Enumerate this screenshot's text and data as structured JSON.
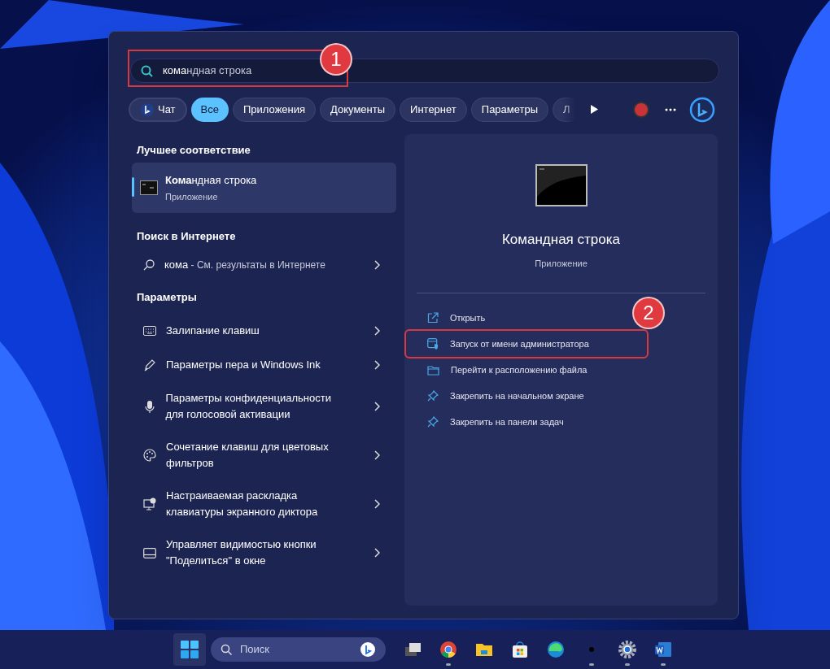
{
  "search": {
    "typed": "кома",
    "suggestion": "ндная строка"
  },
  "filters": [
    {
      "label": "Чат",
      "kind": "chat",
      "selected": false
    },
    {
      "label": "Все",
      "kind": "text",
      "selected": true
    },
    {
      "label": "Приложения",
      "kind": "text",
      "selected": false
    },
    {
      "label": "Документы",
      "kind": "text",
      "selected": false
    },
    {
      "label": "Интернет",
      "kind": "text",
      "selected": false
    },
    {
      "label": "Параметры",
      "kind": "text",
      "selected": false
    },
    {
      "label": "Л",
      "kind": "text",
      "selected": false
    }
  ],
  "best_match": {
    "heading": "Лучшее соответствие",
    "title_typed": "Кома",
    "title_rest": "ндная строка",
    "subtitle": "Приложение",
    "selected": true
  },
  "web_search": {
    "heading": "Поиск в Интернете",
    "query": "кома",
    "text": " - См. результаты в Интернете"
  },
  "settings": {
    "heading": "Параметры",
    "items": [
      {
        "kind": "keyboard",
        "label": "Залипание клавиш"
      },
      {
        "kind": "pen",
        "label": "Параметры пера и Windows Ink"
      },
      {
        "kind": "mic",
        "label": "Параметры конфиденциальности для голосовой активации"
      },
      {
        "kind": "palette",
        "label": "Сочетание клавиш для цветовых фильтров"
      },
      {
        "kind": "narrator",
        "label": "Настраиваемая раскладка клавиатуры экранного диктора"
      },
      {
        "kind": "share",
        "label": "Управляет видимостью кнопки \"Поделиться\" в окне"
      }
    ]
  },
  "preview": {
    "title": "Командная строка",
    "subtitle": "Приложение",
    "actions": [
      {
        "kind": "open",
        "label": "Открыть",
        "highlighted": false
      },
      {
        "kind": "admin",
        "label": "Запуск от имени администратора",
        "highlighted": true
      },
      {
        "kind": "folder",
        "label": "Перейти к расположению файла",
        "highlighted": false
      },
      {
        "kind": "pin",
        "label": "Закрепить на начальном экране",
        "highlighted": false
      },
      {
        "kind": "pin",
        "label": "Закрепить на панели задач",
        "highlighted": false
      }
    ]
  },
  "callouts": [
    "1",
    "2"
  ],
  "taskbar": {
    "search_placeholder": "Поиск",
    "apps": [
      {
        "kind": "taskview",
        "running": false
      },
      {
        "kind": "chrome",
        "running": true
      },
      {
        "kind": "explorer",
        "running": false
      },
      {
        "kind": "store",
        "running": false
      },
      {
        "kind": "edge",
        "running": false
      },
      {
        "kind": "dot",
        "running": true
      },
      {
        "kind": "settings",
        "running": true
      },
      {
        "kind": "word",
        "running": true
      }
    ]
  }
}
